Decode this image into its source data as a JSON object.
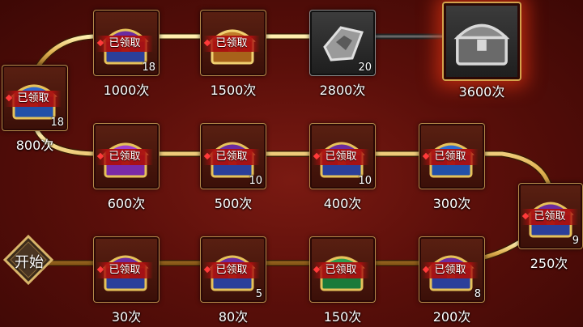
{
  "start_label": "开始",
  "claimed_label": "已领取",
  "colors": {
    "accent": "#e0b050",
    "claimed_bg": "#aa1010",
    "background": "#5b0f0a"
  },
  "nodes": [
    {
      "milestone": "30次",
      "count": "",
      "status": "claimed",
      "chest": "gold-purple"
    },
    {
      "milestone": "80次",
      "count": "5",
      "status": "claimed",
      "chest": "gold-purple"
    },
    {
      "milestone": "150次",
      "count": "",
      "status": "claimed",
      "chest": "green"
    },
    {
      "milestone": "200次",
      "count": "8",
      "status": "claimed",
      "chest": "gold-purple"
    },
    {
      "milestone": "250次",
      "count": "9",
      "status": "claimed",
      "chest": "gold-purple"
    },
    {
      "milestone": "300次",
      "count": "",
      "status": "claimed",
      "chest": "blue"
    },
    {
      "milestone": "400次",
      "count": "10",
      "status": "claimed",
      "chest": "gold-purple"
    },
    {
      "milestone": "500次",
      "count": "10",
      "status": "claimed",
      "chest": "gold-purple"
    },
    {
      "milestone": "600次",
      "count": "",
      "status": "claimed",
      "chest": "purple"
    },
    {
      "milestone": "800次",
      "count": "18",
      "status": "claimed",
      "chest": "blue"
    },
    {
      "milestone": "1000次",
      "count": "18",
      "status": "claimed",
      "chest": "gold-purple"
    },
    {
      "milestone": "1500次",
      "count": "",
      "status": "claimed",
      "chest": "gold"
    },
    {
      "milestone": "2800次",
      "count": "20",
      "status": "locked",
      "chest": "silver-token"
    },
    {
      "milestone": "3600次",
      "count": "",
      "status": "locked",
      "chest": "silver-chest"
    }
  ]
}
